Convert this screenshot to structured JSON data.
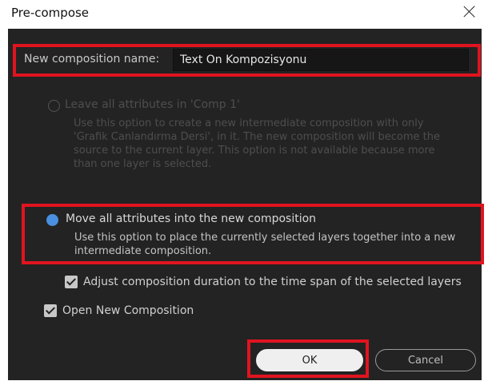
{
  "window": {
    "title": "Pre-compose"
  },
  "name_field": {
    "label": "New composition name:",
    "value": "Text Ön Kompozisyonu"
  },
  "option_leave": {
    "label": "Leave all attributes in 'Comp 1'",
    "desc_lines": [
      "Use this option to create a new intermediate composition with only",
      "'Grafik Canlandırma Dersi', in it. The new composition will become the",
      "source to the current layer. This option is not available because more",
      "than one layer is selected."
    ],
    "selected": false,
    "enabled": false
  },
  "option_move": {
    "label": "Move all attributes into the new composition",
    "desc_lines": [
      "Use this option to place the currently selected layers together into a new",
      "intermediate composition."
    ],
    "selected": true,
    "enabled": true
  },
  "check_adjust": {
    "label": "Adjust composition duration to the time span of the selected layers",
    "checked": true
  },
  "check_open": {
    "label": "Open New Composition",
    "checked": true
  },
  "buttons": {
    "ok": "OK",
    "cancel": "Cancel"
  },
  "colors": {
    "dialog_bg": "#232323",
    "highlight": "#e0141f",
    "radio_accent": "#4a8fe0"
  }
}
